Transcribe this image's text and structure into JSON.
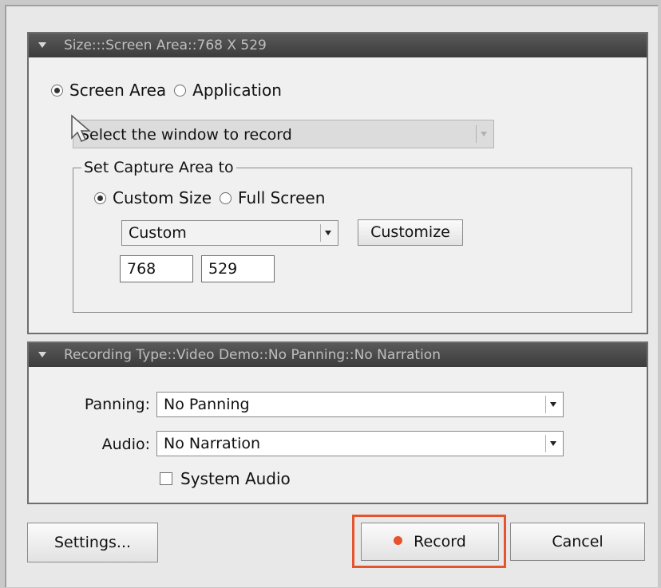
{
  "size_panel": {
    "header": "Size:::Screen Area::768 X 529",
    "mode_options": [
      {
        "label": "Screen Area",
        "selected": true
      },
      {
        "label": "Application",
        "selected": false
      }
    ],
    "window_select": {
      "value": "Select the window to record",
      "disabled": true
    },
    "capture_group": {
      "title": "Set Capture Area to",
      "options": [
        {
          "label": "Custom Size",
          "selected": true
        },
        {
          "label": "Full Screen",
          "selected": false
        }
      ],
      "preset_select": "Custom",
      "customize_button": "Customize",
      "width_value": "768",
      "height_value": "529"
    }
  },
  "recording_panel": {
    "header": "Recording Type::Video Demo::No Panning::No Narration",
    "panning_label": "Panning:",
    "panning_value": "No Panning",
    "audio_label": "Audio:",
    "audio_value": "No Narration",
    "system_audio_label": "System Audio",
    "system_audio_checked": false
  },
  "footer": {
    "settings_button": "Settings...",
    "record_button": "Record",
    "cancel_button": "Cancel"
  },
  "colors": {
    "record_dot": "#e8532a",
    "highlight_border": "#e5542e",
    "header_bg": "#4a4a4a"
  }
}
